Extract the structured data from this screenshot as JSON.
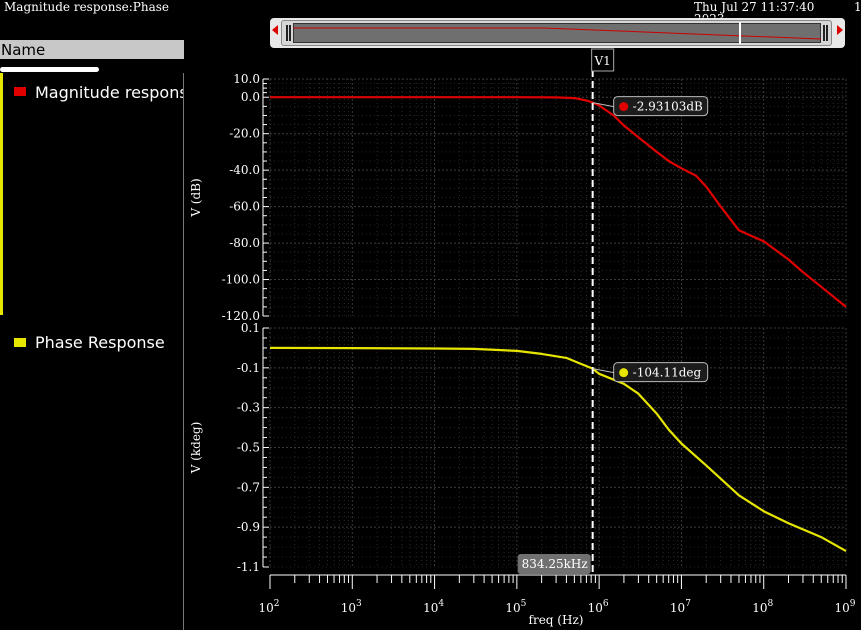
{
  "window": {
    "title": "Magnitude response:Phase",
    "timestamp": "Thu Jul 27 11:37:40",
    "timestamp_year": "2023",
    "corner_text": "1"
  },
  "legend": {
    "header": "Name",
    "items": [
      {
        "label": "Magnitude response",
        "color": "#e00000"
      },
      {
        "label": "Phase Response",
        "color": "#e6e600"
      }
    ]
  },
  "cursor": {
    "name": "V1",
    "freq_label": "834.25kHz",
    "freq_hz": 834250
  },
  "chart_data": [
    {
      "type": "line",
      "series": [
        {
          "name": "Magnitude response",
          "color": "#e00000",
          "x": [
            100,
            1000,
            10000,
            100000,
            300000,
            500000,
            700000,
            834250,
            1000000,
            1500000,
            2000000,
            3000000,
            5000000,
            7000000,
            10000000,
            15000000,
            20000000,
            30000000,
            50000000,
            70000000,
            100000000,
            200000000,
            300000000,
            500000000,
            1000000000
          ],
          "y": [
            0,
            0,
            0,
            0,
            -0.1,
            -0.5,
            -1.8,
            -2.93,
            -4.5,
            -10,
            -15.5,
            -22,
            -30,
            -35,
            -39,
            -43,
            -49,
            -60,
            -73,
            -76,
            -79,
            -89,
            -96,
            -104,
            -115
          ]
        }
      ],
      "ylabel": "V (dB)",
      "ylim": [
        -120,
        10
      ],
      "yticks": [
        "10.0",
        "0.0",
        "-20.0",
        "-40.0",
        "-60.0",
        "-80.0",
        "-100.0",
        "-120.0"
      ],
      "ytick_values": [
        10,
        0,
        -20,
        -40,
        -60,
        -80,
        -100,
        -120
      ],
      "xscale": "log",
      "xlim": [
        100,
        1000000000
      ],
      "grid": true,
      "marker": {
        "label": "-2.93103dB",
        "x": 834250,
        "y": -2.93
      }
    },
    {
      "type": "line",
      "series": [
        {
          "name": "Phase Response",
          "color": "#e6e600",
          "x": [
            100,
            1000,
            10000,
            30000,
            100000,
            200000,
            400000,
            600000,
            834250,
            1000000,
            2000000,
            3000000,
            5000000,
            7000000,
            10000000,
            20000000,
            50000000,
            100000000,
            200000000,
            500000000,
            1000000000
          ],
          "y": [
            0,
            -0.001,
            -0.003,
            -0.005,
            -0.015,
            -0.03,
            -0.05,
            -0.08,
            -0.104,
            -0.13,
            -0.18,
            -0.23,
            -0.33,
            -0.41,
            -0.48,
            -0.59,
            -0.74,
            -0.82,
            -0.88,
            -0.95,
            -1.02
          ],
          "y_units": "kdeg"
        }
      ],
      "ylabel": "V (kdeg)",
      "ylim": [
        -1.1,
        0.1
      ],
      "yticks": [
        "0.1",
        "-0.1",
        "-0.3",
        "-0.5",
        "-0.7",
        "-0.9",
        "-1.1"
      ],
      "ytick_values": [
        0.1,
        -0.1,
        -0.3,
        -0.5,
        -0.7,
        -0.9,
        -1.1
      ],
      "xscale": "log",
      "xlim": [
        100,
        1000000000
      ],
      "xlabel": "freq (Hz)",
      "grid": true,
      "marker": {
        "label": "-104.11deg",
        "x": 834250,
        "y": -0.10411
      }
    }
  ],
  "x_axis": {
    "label": "freq (Hz)",
    "decades": [
      2,
      3,
      4,
      5,
      6,
      7,
      8,
      9
    ]
  }
}
